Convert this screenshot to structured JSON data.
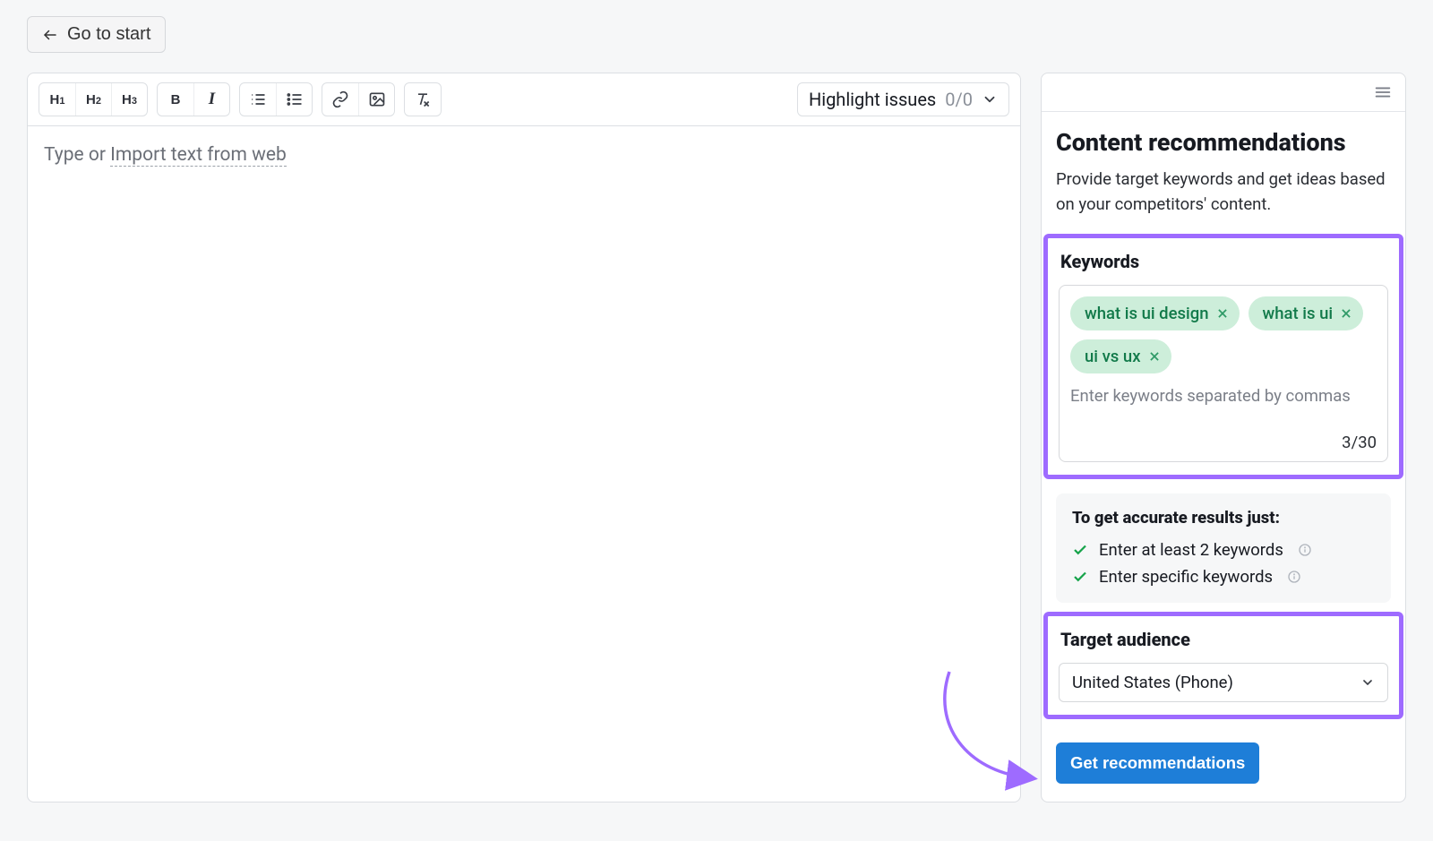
{
  "nav": {
    "go_start": "Go to start"
  },
  "toolbar": {
    "h1": "H",
    "h1s": "1",
    "h2": "H",
    "h2s": "2",
    "h3": "H",
    "h3s": "3",
    "bold": "B",
    "highlight_label": "Highlight issues",
    "highlight_count": "0/0"
  },
  "editor": {
    "placeholder_pre": "Type or ",
    "placeholder_link": "Import text from web"
  },
  "side": {
    "title": "Content recommendations",
    "subtitle": "Provide target keywords and get ideas based on your competitors' content.",
    "keywords_label": "Keywords",
    "keywords": [
      "what is ui design",
      "what is ui",
      "ui vs ux"
    ],
    "keywords_placeholder": "Enter keywords separated by commas",
    "keywords_count": "3/30",
    "tips_title": "To get accurate results just:",
    "tip1": "Enter at least 2 keywords",
    "tip2": "Enter specific keywords",
    "audience_label": "Target audience",
    "audience_value": "United States (Phone)",
    "cta": "Get recommendations"
  }
}
